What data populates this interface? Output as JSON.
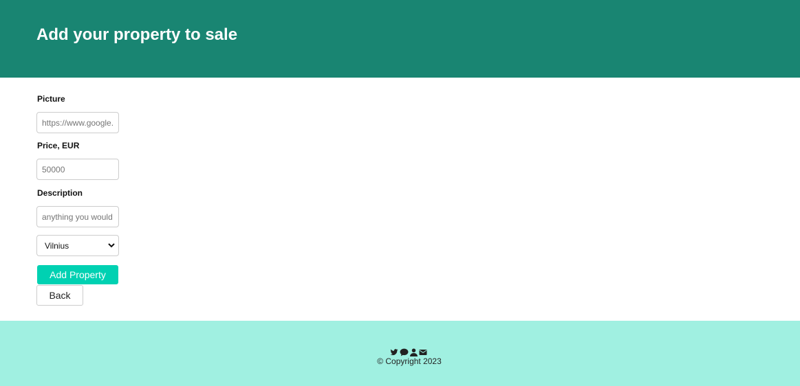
{
  "header": {
    "title": "Add your property to sale",
    "background_color": "#198572"
  },
  "form": {
    "picture": {
      "label": "Picture",
      "placeholder": "https://www.google.com"
    },
    "price": {
      "label": "Price, EUR",
      "placeholder": "50000"
    },
    "description": {
      "label": "Description",
      "placeholder": "anything you would like to add"
    },
    "city": {
      "selected": "Vilnius",
      "icon": "chevron-down-icon"
    },
    "add_button_label": "Add Property",
    "back_button_label": "Back",
    "accent_color": "#00d1b2"
  },
  "footer": {
    "icons": [
      "twitter-icon",
      "chat-bubble-icon",
      "user-icon",
      "envelope-icon"
    ],
    "copyright": "© Copyright 2023",
    "background_color": "#a0f0e1"
  }
}
